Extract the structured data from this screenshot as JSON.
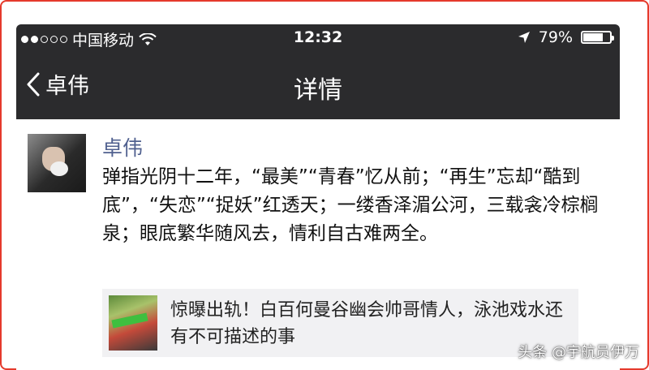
{
  "status_bar": {
    "carrier": "中国移动",
    "time": "12:32",
    "battery_percent": "79%",
    "battery_level": 0.79,
    "signal_bars_filled": 2,
    "signal_bars_total": 5
  },
  "nav": {
    "back_label": "卓伟",
    "title": "详情"
  },
  "post": {
    "author": "卓伟",
    "text": "弹指光阴十二年，“最美”“青春”忆从前；“再生”忘却“酷到底”，“失恋”“捉妖”红透天；一缕香泽湄公河，三载衾冷棕榈泉；眼底繁华随风去，情利自古难两全。",
    "link_card": {
      "title": "惊曝出轨！白百何曼谷幽会帅哥情人，泳池戏水还有不可描述的事"
    }
  },
  "watermark": "头条 @宇航员伊万",
  "colors": {
    "nav_background": "#2b2b2d",
    "author_link": "#50608f",
    "frame_border": "#e53a2c",
    "card_background": "#f1f1f3"
  },
  "icons": [
    "wifi-icon",
    "location-arrow-icon",
    "battery-icon",
    "back-chevron-icon"
  ]
}
